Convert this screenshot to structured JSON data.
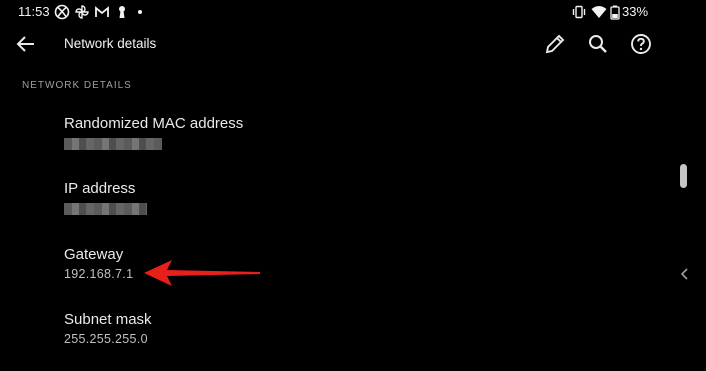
{
  "status_bar": {
    "time": "11:53",
    "battery": "33%"
  },
  "app_bar": {
    "title": "Network details"
  },
  "section": {
    "header": "NETWORK DETAILS"
  },
  "items": [
    {
      "label": "Randomized MAC address",
      "value": ""
    },
    {
      "label": "IP address",
      "value": ""
    },
    {
      "label": "Gateway",
      "value": "192.168.7.1"
    },
    {
      "label": "Subnet mask",
      "value": "255.255.255.0"
    }
  ],
  "colors": {
    "background": "#000000",
    "annotation_arrow": "#e8201a"
  }
}
